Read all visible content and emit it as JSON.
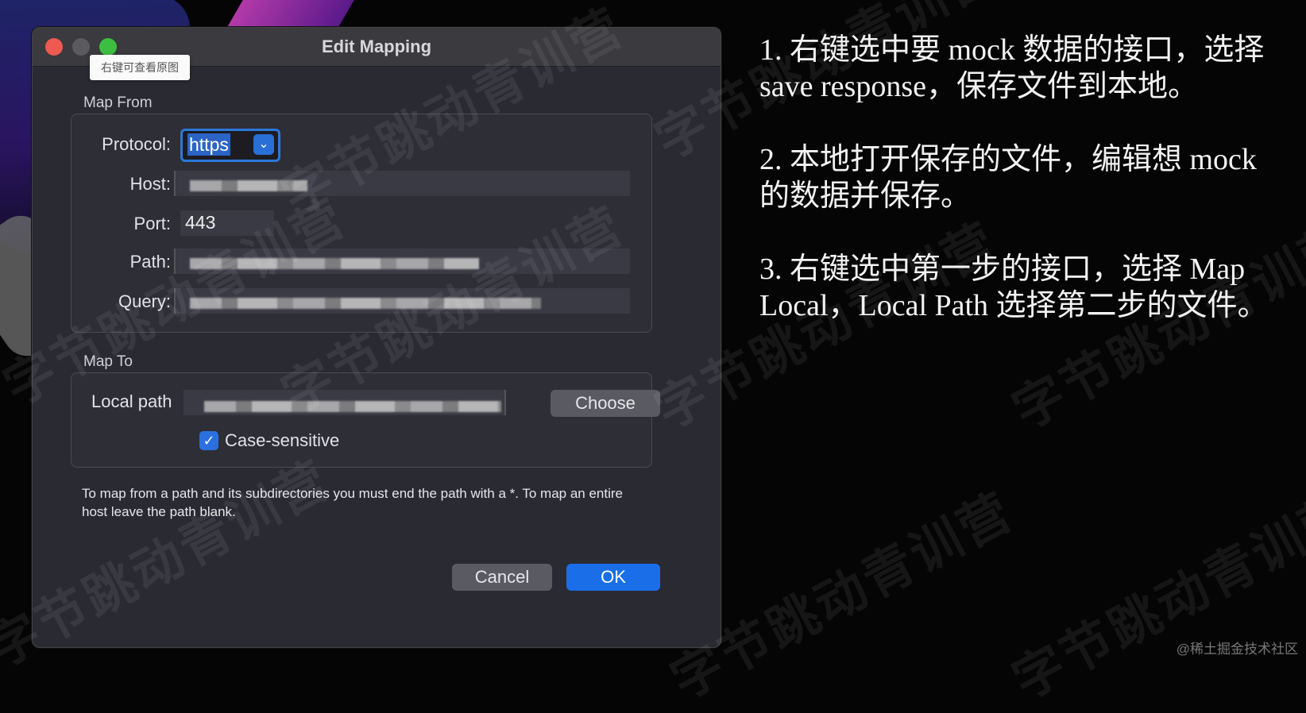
{
  "dialog": {
    "title": "Edit Mapping",
    "tooltip": "右键可查看原图",
    "map_from": {
      "label": "Map From",
      "protocol_label": "Protocol:",
      "protocol_value": "https",
      "host_label": "Host:",
      "port_label": "Port:",
      "port_value": "443",
      "path_label": "Path:",
      "query_label": "Query:"
    },
    "map_to": {
      "label": "Map To",
      "local_path_label": "Local path",
      "choose_label": "Choose",
      "case_sensitive_label": "Case-sensitive",
      "case_sensitive_checked": true
    },
    "hint": "To map from a path and its subdirectories you must end the path with a *. To map an entire host leave the path blank.",
    "cancel_label": "Cancel",
    "ok_label": "OK"
  },
  "instructions": [
    "1. 右键选中要 mock 数据的接口，选择save response，保存文件到本地。",
    "2. 本地打开保存的文件，编辑想 mock 的数据并保存。",
    "3. 右键选中第一步的接口，选择 Map Local，Local Path 选择第二步的文件。"
  ],
  "watermark_text": "字节跳动青训营",
  "credit": "@稀土掘金技术社区",
  "colors": {
    "accent": "#1a6ee8",
    "close": "#ee5a52",
    "maximize": "#3cbf40"
  }
}
